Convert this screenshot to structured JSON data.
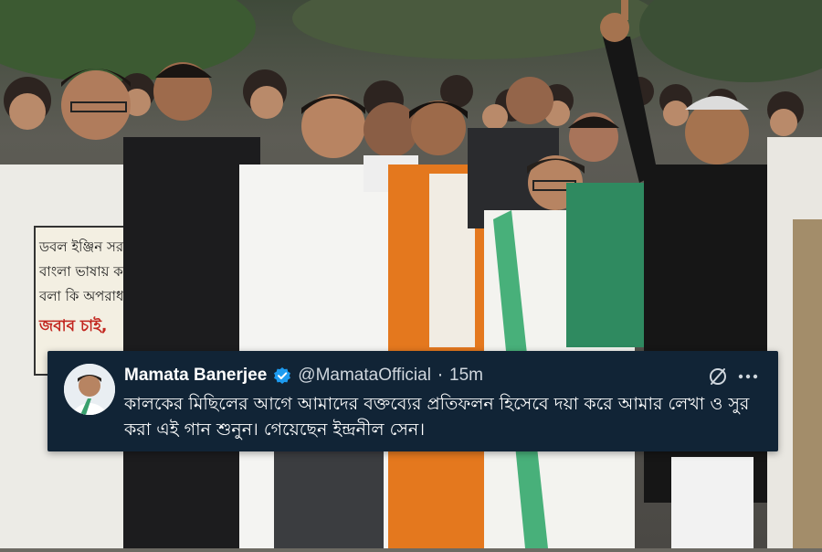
{
  "photo": {
    "placard": {
      "lines": [
        "ডবল ইঞ্জিন সরকার,",
        "বাংলা ভাষায় কথা",
        "বলা কি অপরাধ ?",
        "জবাব চাই,"
      ]
    }
  },
  "tweet": {
    "name": "Mamata Banerjee",
    "handle": "@MamataOfficial",
    "separator": "·",
    "time": "15m",
    "text": "কালকের মিছিলের আগে আমাদের বক্তব্যের প্রতিফলন হিসেবে দয়া করে আমার লেখা ও সুর করা এই গান শুনুন। গেয়েছেন ইন্দ্রনীল সেন।",
    "verified_color": "#1d9bf0",
    "card_color": "#112436",
    "icons": {
      "verified": "verified-badge-icon",
      "grok": "grok-icon",
      "more": "more-dots-icon"
    }
  }
}
